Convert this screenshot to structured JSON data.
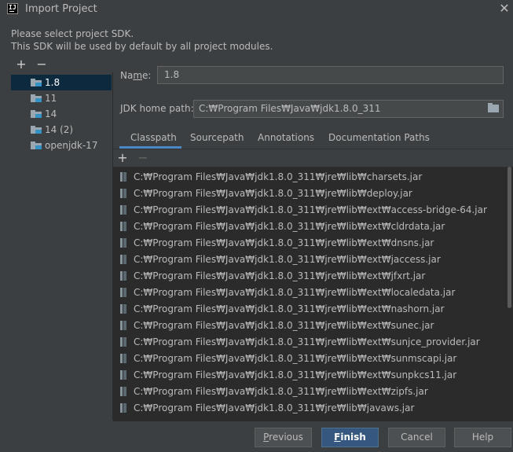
{
  "window": {
    "title": "Import Project",
    "icon": "intellij-idea-icon",
    "app_icon_text": "IJ"
  },
  "instructions": {
    "line1": "Please select project SDK.",
    "line2": "This SDK will be used by default by all project modules."
  },
  "sdk_toolbar": {
    "add": "+",
    "remove": "−"
  },
  "sdk_list": [
    {
      "label": "1.8",
      "selected": true
    },
    {
      "label": "11",
      "selected": false
    },
    {
      "label": "14",
      "selected": false
    },
    {
      "label": "14 (2)",
      "selected": false
    },
    {
      "label": "openjdk-17",
      "selected": false
    }
  ],
  "form": {
    "name_label_prefix": "Na",
    "name_label_mnemonic": "m",
    "name_label_suffix": "e:",
    "name_value": "1.8",
    "jdk_home_label": "JDK home path:",
    "jdk_home_value": "C:₩Program Files₩Java₩jdk1.8.0_311"
  },
  "tabs": [
    {
      "label": "Classpath",
      "active": true
    },
    {
      "label": "Sourcepath",
      "active": false
    },
    {
      "label": "Annotations",
      "active": false
    },
    {
      "label": "Documentation Paths",
      "active": false
    }
  ],
  "path_toolbar": {
    "add": "+",
    "remove": "−"
  },
  "classpath": [
    "C:₩Program Files₩Java₩jdk1.8.0_311₩jre₩lib₩charsets.jar",
    "C:₩Program Files₩Java₩jdk1.8.0_311₩jre₩lib₩deploy.jar",
    "C:₩Program Files₩Java₩jdk1.8.0_311₩jre₩lib₩ext₩access-bridge-64.jar",
    "C:₩Program Files₩Java₩jdk1.8.0_311₩jre₩lib₩ext₩cldrdata.jar",
    "C:₩Program Files₩Java₩jdk1.8.0_311₩jre₩lib₩ext₩dnsns.jar",
    "C:₩Program Files₩Java₩jdk1.8.0_311₩jre₩lib₩ext₩jaccess.jar",
    "C:₩Program Files₩Java₩jdk1.8.0_311₩jre₩lib₩ext₩jfxrt.jar",
    "C:₩Program Files₩Java₩jdk1.8.0_311₩jre₩lib₩ext₩localedata.jar",
    "C:₩Program Files₩Java₩jdk1.8.0_311₩jre₩lib₩ext₩nashorn.jar",
    "C:₩Program Files₩Java₩jdk1.8.0_311₩jre₩lib₩ext₩sunec.jar",
    "C:₩Program Files₩Java₩jdk1.8.0_311₩jre₩lib₩ext₩sunjce_provider.jar",
    "C:₩Program Files₩Java₩jdk1.8.0_311₩jre₩lib₩ext₩sunmscapi.jar",
    "C:₩Program Files₩Java₩jdk1.8.0_311₩jre₩lib₩ext₩sunpkcs11.jar",
    "C:₩Program Files₩Java₩jdk1.8.0_311₩jre₩lib₩ext₩zipfs.jar",
    "C:₩Program Files₩Java₩jdk1.8.0_311₩jre₩lib₩javaws.jar"
  ],
  "buttons": {
    "previous_mnemonic": "P",
    "previous_rest": "revious",
    "finish_mnemonic": "F",
    "finish_rest": "inish",
    "cancel": "Cancel",
    "help": "Help"
  },
  "colors": {
    "background": "#3c3f41",
    "list_background": "#2b2b2b",
    "selection": "#0d293e",
    "accent": "#4a88c7",
    "primary_button": "#365880"
  }
}
